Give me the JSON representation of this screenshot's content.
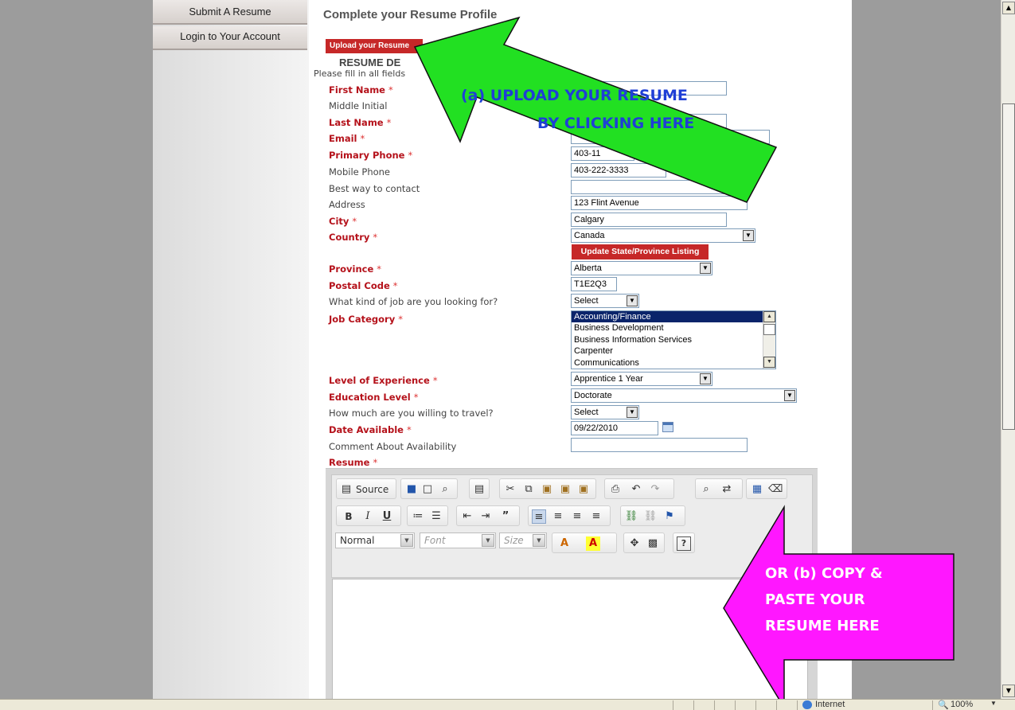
{
  "sidebar": {
    "items": [
      {
        "label": "Submit A Resume"
      },
      {
        "label": "Login to Your Account"
      }
    ]
  },
  "page": {
    "title": "Complete your Resume Profile",
    "upload_button": "Upload your Resume",
    "section_heading": "RESUME DE",
    "fill_note": "Please fill in all fields"
  },
  "form": {
    "required_mark": "*",
    "first_name": {
      "label": "First Name",
      "value": ""
    },
    "middle_initial": {
      "label": "Middle Initial"
    },
    "last_name": {
      "label": "Last Name",
      "value": ""
    },
    "email": {
      "label": "Email",
      "value": ""
    },
    "primary_phone": {
      "label": "Primary Phone",
      "value": "403-11"
    },
    "mobile_phone": {
      "label": "Mobile Phone",
      "value": "403-222-3333"
    },
    "best_way": {
      "label": "Best way to contact",
      "value": ""
    },
    "address": {
      "label": "Address",
      "value": "123 Flint Avenue"
    },
    "city": {
      "label": "City",
      "value": "Calgary"
    },
    "country": {
      "label": "Country",
      "value": "Canada"
    },
    "update_button": "Update State/Province Listing",
    "province": {
      "label": "Province",
      "value": "Alberta"
    },
    "postal_code": {
      "label": "Postal Code",
      "value": "T1E2Q3"
    },
    "job_kind": {
      "label": "What kind of job are you looking for?",
      "value": "Select"
    },
    "job_category": {
      "label": "Job Category",
      "options": [
        "Accounting/Finance",
        "Business Development",
        "Business Information Services",
        "Carpenter",
        "Communications"
      ],
      "selected": "Accounting/Finance"
    },
    "experience": {
      "label": "Level of Experience",
      "value": "Apprentice 1 Year"
    },
    "education": {
      "label": "Education Level",
      "value": "Doctorate"
    },
    "travel": {
      "label": "How much are you willing to travel?",
      "value": "Select"
    },
    "date_available": {
      "label": "Date Available",
      "value": "09/22/2010"
    },
    "availability_comment": {
      "label": "Comment About Availability",
      "value": ""
    },
    "resume": {
      "label": "Resume"
    }
  },
  "editor": {
    "source_label": "Source",
    "format_combo": "Normal",
    "font_combo": "Font",
    "size_combo": "Size"
  },
  "annotations": {
    "upload_line1": "(a) UPLOAD YOUR RESUME",
    "upload_line2": "BY CLICKING HERE",
    "paste_line1": "OR (b) COPY &",
    "paste_line2": "PASTE YOUR",
    "paste_line3": "RESUME HERE",
    "upload_arrow_color": "#22e022",
    "paste_arrow_color": "#ff17ff"
  },
  "statusbar": {
    "zone": "Internet",
    "zoom": "100%"
  }
}
